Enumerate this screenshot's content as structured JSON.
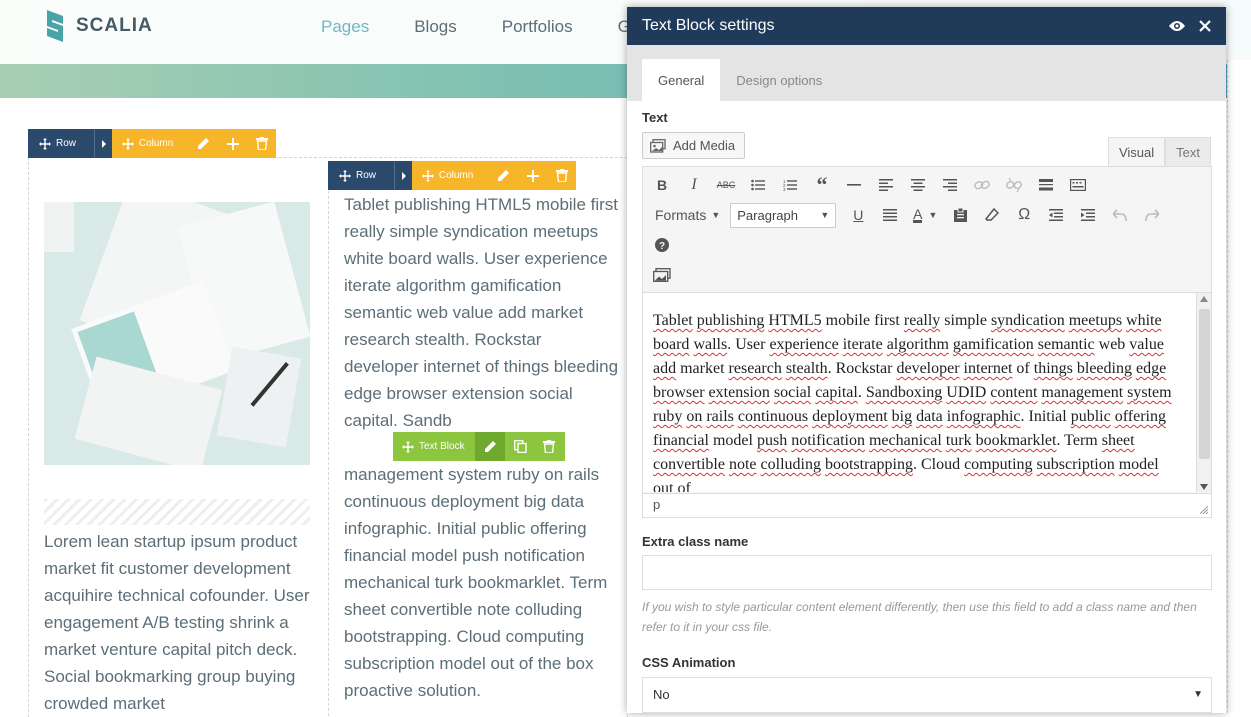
{
  "site": {
    "logo_text": "SCALIA",
    "nav": [
      "Pages",
      "Blogs",
      "Portfolios",
      "G"
    ]
  },
  "builder": {
    "row_label": "Row",
    "column_label": "Column",
    "text_block_label": "Text Block",
    "left_text": "Lorem lean startup ipsum product market fit customer development acquihire technical cofounder. User engagement A/B testing shrink a market venture capital pitch deck. Social bookmarking group buying crowded market",
    "mid_text_before": "Tablet publishing HTML5 mobile first really simple syndication meetups white board walls. User experience iterate algorithm gamification semantic web value add market research stealth. Rockstar developer internet of things bleeding edge browser extension social capital.",
    "mid_text_partial": "Sandb",
    "mid_text_after": "management system ruby on rails continuous deployment big data infographic. Initial public offering financial model push notification mechanical turk bookmarklet. Term sheet convertible note colluding bootstrapping. Cloud computing subscription model out of the box proactive solution."
  },
  "panel": {
    "title": "Text Block settings",
    "tabs": [
      "General",
      "Design options"
    ],
    "text_label": "Text",
    "add_media": "Add Media",
    "editor_tabs": [
      "Visual",
      "Text"
    ],
    "formats": "Formats",
    "paragraph": "Paragraph",
    "editor_path": "p",
    "extra_class_label": "Extra class name",
    "extra_class_value": "",
    "help_text": "If you wish to style particular content element differently, then use this field to add a class name and then refer to it in your css file.",
    "css_animation_label": "CSS Animation",
    "css_animation_value": "No"
  },
  "icons": [
    "plus-move-icon",
    "chevron-right-icon",
    "pencil-icon",
    "plus-icon",
    "trash-icon",
    "copy-icon",
    "eye-icon",
    "close-icon",
    "add-media-icon"
  ],
  "colors": {
    "row_control": "#2b4a6b",
    "column_control": "#f7b62a",
    "text_block_control": "#8cc63f",
    "panel_header": "#203a5a",
    "nav_active": "#6fb8c6"
  }
}
